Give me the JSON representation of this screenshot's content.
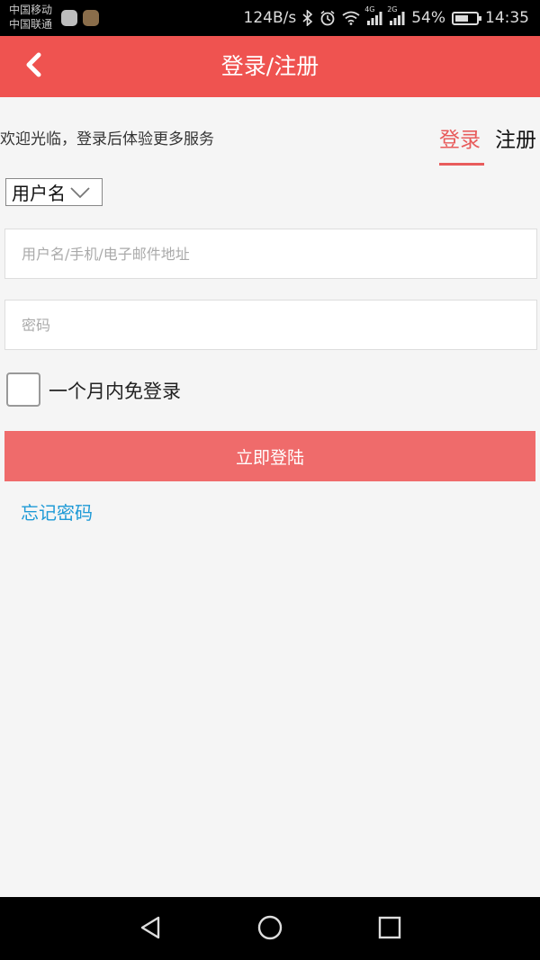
{
  "status_bar": {
    "carrier_1": "中国移动",
    "carrier_2": "中国联通",
    "net_speed": "124B/s",
    "signal_1_label": "4G",
    "signal_2_label": "2G",
    "battery_percent": "54%",
    "battery_level": 0.54,
    "time": "14:35",
    "icons": [
      "chat-app-icon",
      "game-app-icon",
      "bluetooth-icon",
      "alarm-icon",
      "wifi-icon",
      "signal-icon",
      "battery-icon"
    ]
  },
  "header": {
    "title": "登录/注册",
    "back_icon": "chevron-left-icon",
    "background_color": "#ef5350"
  },
  "welcome": {
    "text": "欢迎光临，登录后体验更多服务"
  },
  "tabs": {
    "login_label": "登录",
    "register_label": "注册",
    "active": "login",
    "active_color": "#e85c5c"
  },
  "form": {
    "account_type": {
      "selected": "用户名",
      "options": [
        "用户名"
      ]
    },
    "username_placeholder": "用户名/手机/电子邮件地址",
    "username_value": "",
    "password_placeholder": "密码",
    "password_value": "",
    "remember_label": "一个月内免登录",
    "remember_checked": false,
    "submit_label": "立即登陆",
    "submit_color": "#ef6b6b",
    "forgot_label": "忘记密码",
    "forgot_color": "#1e9ad6"
  },
  "nav_bar": {
    "icons": [
      "back-triangle-icon",
      "home-circle-icon",
      "recents-square-icon"
    ]
  }
}
